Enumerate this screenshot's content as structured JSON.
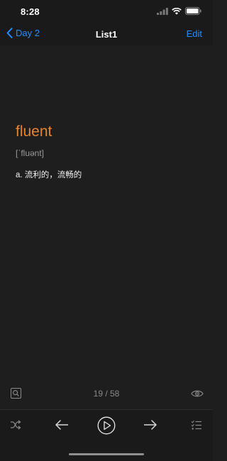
{
  "status": {
    "time": "8:28",
    "icons": [
      "cellular-icon",
      "wifi-icon",
      "battery-icon"
    ]
  },
  "nav": {
    "back_label": "Day 2",
    "title": "List1",
    "edit_label": "Edit"
  },
  "card": {
    "word": "fluent",
    "phonetic": "[ˈfluənt]",
    "meaning": "a. 流利的，流畅的"
  },
  "progress": {
    "counter": "19 / 58",
    "current": 19,
    "total": 58
  },
  "toolbar": {
    "buttons": [
      "shuffle-icon",
      "arrow-left-icon",
      "play-icon",
      "arrow-right-icon",
      "list-icon"
    ]
  },
  "colors": {
    "accent": "#1f8fff",
    "word": "#e4852c",
    "background": "#1e1e1e"
  }
}
